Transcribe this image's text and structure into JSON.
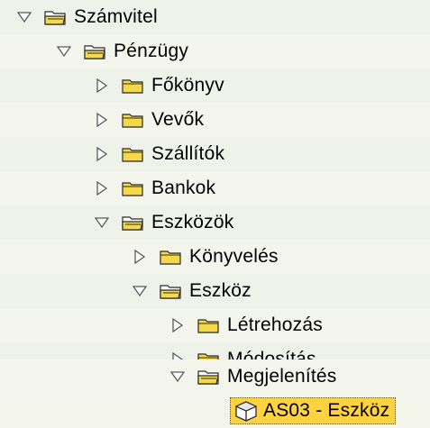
{
  "tree": {
    "nodes": [
      {
        "label": "Számvitel",
        "expanded": true
      },
      {
        "label": "Pénzügy",
        "expanded": true
      },
      {
        "label": "Főkönyv",
        "expanded": false
      },
      {
        "label": "Vevők",
        "expanded": false
      },
      {
        "label": "Szállítók",
        "expanded": false
      },
      {
        "label": "Bankok",
        "expanded": false
      },
      {
        "label": "Eszközök",
        "expanded": true
      },
      {
        "label": "Könyvelés",
        "expanded": false
      },
      {
        "label": "Eszköz",
        "expanded": true
      },
      {
        "label": "Létrehozás",
        "expanded": false
      },
      {
        "label": "Módosítás",
        "expanded": false
      },
      {
        "label": "Megjelenítés",
        "expanded": true
      }
    ],
    "leaf": {
      "label": "AS03 - Eszköz",
      "icon": "transaction-cube-icon",
      "selected": true
    }
  },
  "colors": {
    "folder_fill": "#f5d94a",
    "folder_outline": "#2a2a2a",
    "selection": "#ffd23f",
    "triangle": "#5a5a5a"
  }
}
